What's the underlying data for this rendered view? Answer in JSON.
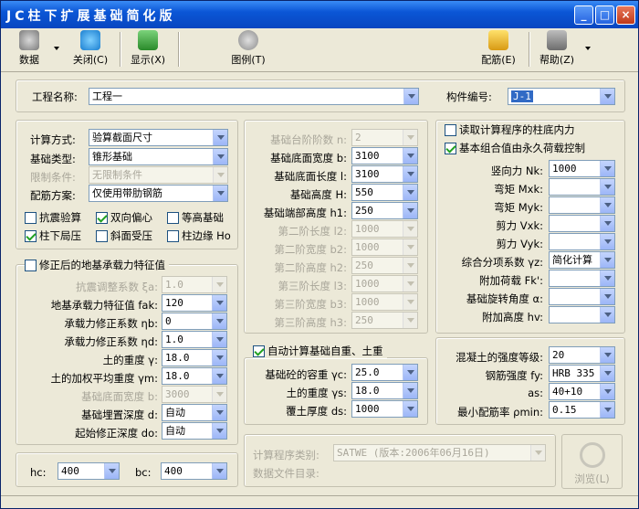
{
  "window": {
    "title": "JC柱下扩展基础简化版",
    "title_logo": "JC",
    "title_text": "柱下扩展基础简化版"
  },
  "toolbar": {
    "data": "数据",
    "close": "关闭(C)",
    "display": "显示(X)",
    "legend": "图例(T)",
    "rebar": "配筋(E)",
    "help": "帮助(Z)"
  },
  "header": {
    "project_label": "工程名称:",
    "project_value": "工程一",
    "member_label": "构件编号:",
    "member_value": "J-1"
  },
  "calc": {
    "method_label": "计算方式:",
    "method_value": "验算截面尺寸",
    "type_label": "基础类型:",
    "type_value": "锥形基础",
    "limit_label": "限制条件:",
    "limit_value": "无限制条件",
    "rebar_label": "配筋方案:",
    "rebar_value": "仅使用带肋钢筋",
    "checks": [
      {
        "label": "抗震验算",
        "checked": false
      },
      {
        "label": "双向偏心",
        "checked": true
      },
      {
        "label": "等高基础",
        "checked": false
      },
      {
        "label": "柱下局压",
        "checked": true
      },
      {
        "label": "斜面受压",
        "checked": false
      },
      {
        "label": "柱边缘 Ho",
        "checked": false
      }
    ]
  },
  "soil": {
    "title": "修正后的地基承载力特征值",
    "rows": [
      {
        "label": "抗震调整系数 ξa:",
        "value": "1.0",
        "disabled": true
      },
      {
        "label": "地基承载力特征值 fak:",
        "value": "120",
        "disabled": false
      },
      {
        "label": "承载力修正系数 ηb:",
        "value": "0",
        "disabled": false
      },
      {
        "label": "承载力修正系数 ηd:",
        "value": "1.0",
        "disabled": false
      },
      {
        "label": "土的重度 γ:",
        "value": "18.0",
        "disabled": false
      },
      {
        "label": "土的加权平均重度 γm:",
        "value": "18.0",
        "disabled": false
      },
      {
        "label": "基础底面宽度 b:",
        "value": "3000",
        "disabled": true
      },
      {
        "label": "基础埋置深度 d:",
        "value": "自动",
        "disabled": false
      },
      {
        "label": "起始修正深度 do:",
        "value": "自动",
        "disabled": false
      }
    ]
  },
  "col": {
    "hc_label": "hc:",
    "hc_value": "400",
    "bc_label": "bc:",
    "bc_value": "400"
  },
  "geom": {
    "rows": [
      {
        "label": "基础台阶阶数 n:",
        "value": "2",
        "disabled": true
      },
      {
        "label": "基础底面宽度 b:",
        "value": "3100",
        "disabled": false
      },
      {
        "label": "基础底面长度 l:",
        "value": "3100",
        "disabled": false
      },
      {
        "label": "基础高度 H:",
        "value": "550",
        "disabled": false
      },
      {
        "label": "基础端部高度 h1:",
        "value": "250",
        "disabled": false
      },
      {
        "label": "第二阶长度 l2:",
        "value": "1000",
        "disabled": true
      },
      {
        "label": "第二阶宽度 b2:",
        "value": "1000",
        "disabled": true
      },
      {
        "label": "第二阶高度 h2:",
        "value": "250",
        "disabled": true
      },
      {
        "label": "第三阶长度 l3:",
        "value": "1000",
        "disabled": true
      },
      {
        "label": "第三阶宽度 b3:",
        "value": "1000",
        "disabled": true
      },
      {
        "label": "第三阶高度 h3:",
        "value": "250",
        "disabled": true
      }
    ]
  },
  "selfweight": {
    "title": "自动计算基础自重、土重",
    "rows": [
      {
        "label": "基础砼的容重 γc:",
        "value": "25.0"
      },
      {
        "label": "土的重度 γs:",
        "value": "18.0"
      },
      {
        "label": "覆土厚度 ds:",
        "value": "1000"
      }
    ]
  },
  "program": {
    "type_label": "计算程序类别:",
    "type_value": "SATWE (版本:2006年06月16日)",
    "file_label": "数据文件目录:"
  },
  "loads": {
    "read_label": "读取计算程序的柱底内力",
    "basic_label": "基本组合值由永久荷载控制",
    "rows": [
      {
        "label": "竖向力 Nk:",
        "value": "1000"
      },
      {
        "label": "弯矩 Mxk:",
        "value": ""
      },
      {
        "label": "弯矩 Myk:",
        "value": ""
      },
      {
        "label": "剪力 Vxk:",
        "value": ""
      },
      {
        "label": "剪力 Vyk:",
        "value": ""
      },
      {
        "label": "综合分项系数 γz:",
        "value": "简化计算"
      },
      {
        "label": "附加荷载 Fk':",
        "value": ""
      },
      {
        "label": "基础旋转角度 α:",
        "value": ""
      },
      {
        "label": "附加高度 hv:",
        "value": ""
      }
    ]
  },
  "material": {
    "rows": [
      {
        "label": "混凝土的强度等级:",
        "value": "20"
      },
      {
        "label": "钢筋强度 fy:",
        "value": "HRB 335"
      },
      {
        "label": "as:",
        "value": "40+10"
      },
      {
        "label": "最小配筋率 ρmin:",
        "value": "0.15"
      }
    ]
  },
  "browse": {
    "label": "浏览(L)"
  },
  "colors": {
    "title_bar": "#0b56d6",
    "window_bg": "#ece9d8",
    "selection": "#316ac5",
    "check_green": "#21a121"
  },
  "icons": [
    "data-icon",
    "close-icon",
    "display-icon",
    "legend-icon",
    "rebar-icon",
    "help-icon",
    "magnifier-icon"
  ]
}
